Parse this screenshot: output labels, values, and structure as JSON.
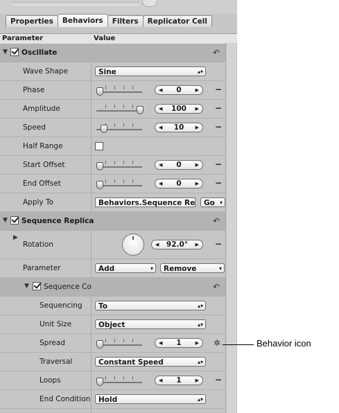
{
  "tabs": [
    "Properties",
    "Behaviors",
    "Filters",
    "Replicator Cell"
  ],
  "columns": {
    "parameter": "Parameter",
    "value": "Value"
  },
  "oscillate": {
    "title": "Oscillate",
    "wave_shape_label": "Wave Shape",
    "wave_shape_value": "Sine",
    "phase_label": "Phase",
    "phase_value": "0",
    "amplitude_label": "Amplitude",
    "amplitude_value": "100",
    "speed_label": "Speed",
    "speed_value": "10",
    "half_range_label": "Half Range",
    "start_offset_label": "Start Offset",
    "start_offset_value": "0",
    "end_offset_label": "End Offset",
    "end_offset_value": "0",
    "apply_to_label": "Apply To",
    "apply_to_value": "Behaviors.Sequence Replica",
    "go_label": "Go"
  },
  "sequence_replicator": {
    "title": "Sequence Replica",
    "rotation_label": "Rotation",
    "rotation_value": "92.0°",
    "parameter_label": "Parameter",
    "add_label": "Add",
    "remove_label": "Remove"
  },
  "sequence_control": {
    "title": "Sequence Co",
    "sequencing_label": "Sequencing",
    "sequencing_value": "To",
    "unit_size_label": "Unit Size",
    "unit_size_value": "Object",
    "spread_label": "Spread",
    "spread_value": "1",
    "traversal_label": "Traversal",
    "traversal_value": "Constant Speed",
    "loops_label": "Loops",
    "loops_value": "1",
    "end_condition_label": "End Condition",
    "end_condition_value": "Hold"
  },
  "callout": "Behavior icon",
  "slider_levels": {
    "phase": 0.0,
    "amplitude": 1.0,
    "speed": 0.1,
    "start_offset": 0.0,
    "end_offset": 0.0,
    "spread": 0.0,
    "loops": 0.0
  }
}
